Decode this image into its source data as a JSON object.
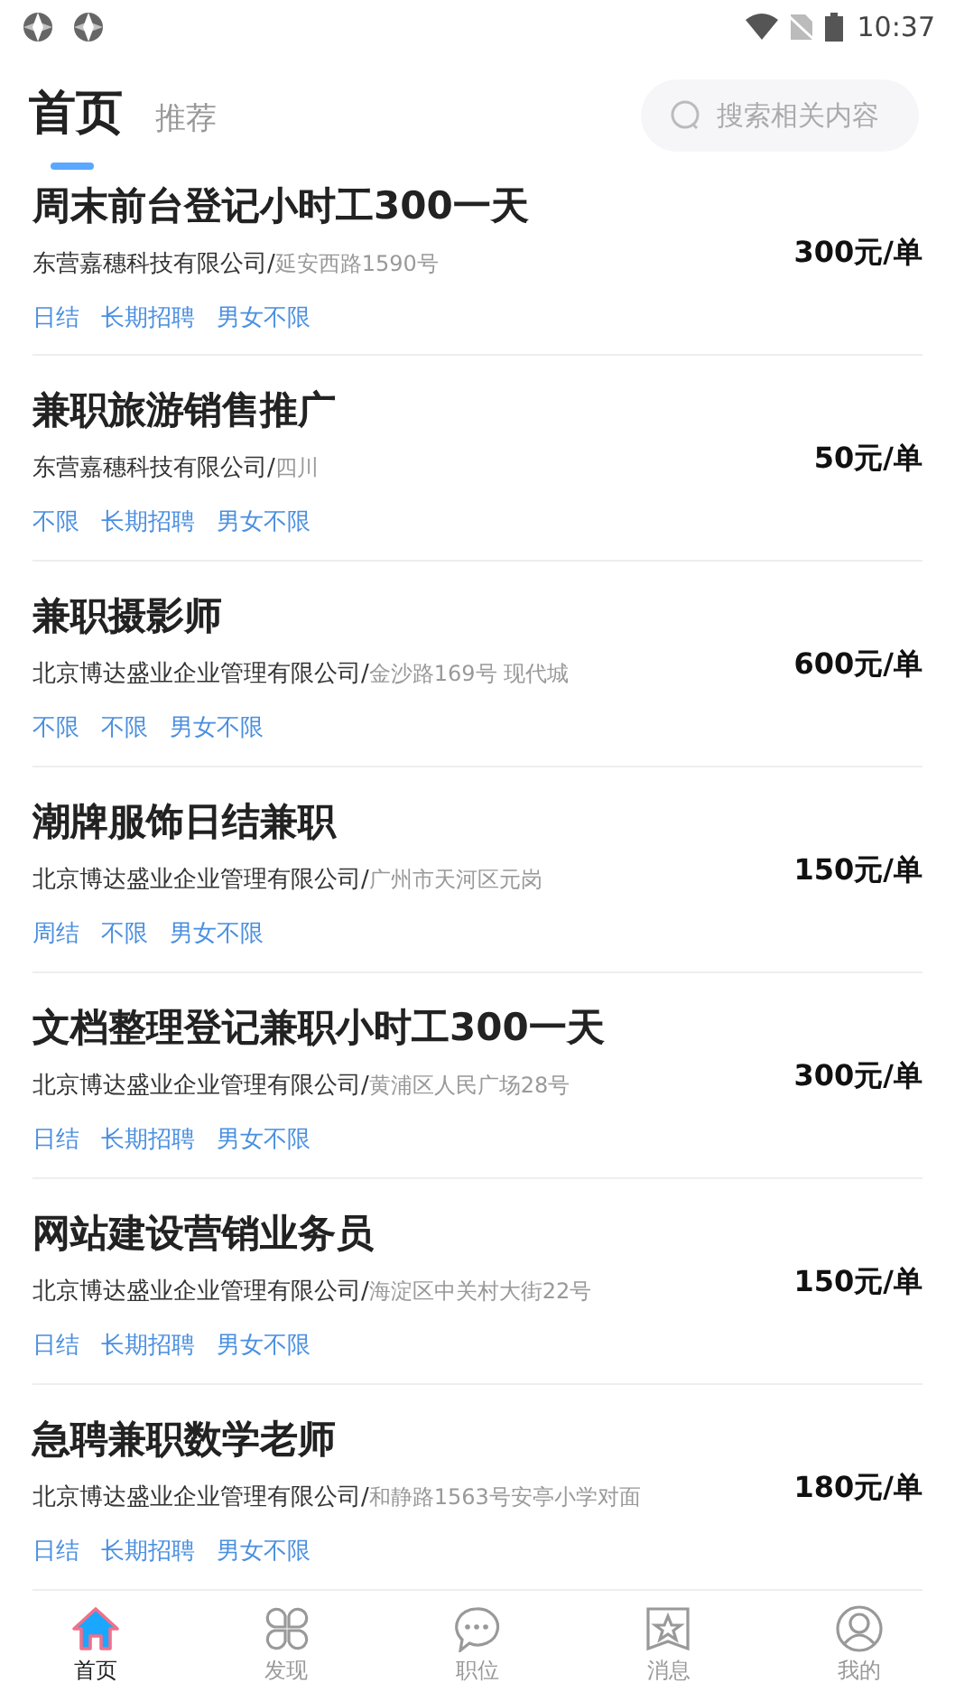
{
  "status_bar": {
    "time": "10:37"
  },
  "tabs": [
    {
      "label": "首页",
      "selected": true
    },
    {
      "label": "推荐",
      "selected": false
    }
  ],
  "search": {
    "placeholder": "搜索相关内容"
  },
  "jobs": [
    {
      "title": "周末前台登记小时工300一天",
      "company": "东营嘉穗科技有限公司/",
      "location": "延安西路1590号",
      "price": "300元/单",
      "tags": [
        "日结",
        "长期招聘",
        "男女不限"
      ]
    },
    {
      "title": "兼职旅游销售推广",
      "company": "东营嘉穗科技有限公司/",
      "location": "四川",
      "price": "50元/单",
      "tags": [
        "不限",
        "长期招聘",
        "男女不限"
      ]
    },
    {
      "title": "兼职摄影师",
      "company": "北京博达盛业企业管理有限公司/",
      "location": "金沙路169号 现代城",
      "price": "600元/单",
      "tags": [
        "不限",
        "不限",
        "男女不限"
      ]
    },
    {
      "title": "潮牌服饰日结兼职",
      "company": "北京博达盛业企业管理有限公司/",
      "location": "广州市天河区元岗",
      "price": "150元/单",
      "tags": [
        "周结",
        "不限",
        "男女不限"
      ]
    },
    {
      "title": "文档整理登记兼职小时工300一天",
      "company": "北京博达盛业企业管理有限公司/",
      "location": "黄浦区人民广场28号",
      "price": "300元/单",
      "tags": [
        "日结",
        "长期招聘",
        "男女不限"
      ]
    },
    {
      "title": "网站建设营销业务员",
      "company": "北京博达盛业企业管理有限公司/",
      "location": "海淀区中关村大街22号",
      "price": "150元/单",
      "tags": [
        "日结",
        "长期招聘",
        "男女不限"
      ]
    },
    {
      "title": "急聘兼职数学老师",
      "company": "北京博达盛业企业管理有限公司/",
      "location": "和静路1563号安亭小学对面",
      "price": "180元/单",
      "tags": [
        "日结",
        "长期招聘",
        "男女不限"
      ]
    }
  ],
  "bottom_nav": [
    {
      "label": "首页",
      "kind": "home",
      "selected": true
    },
    {
      "label": "发现",
      "kind": "discover",
      "selected": false
    },
    {
      "label": "职位",
      "kind": "chat",
      "selected": false
    },
    {
      "label": "消息",
      "kind": "star",
      "selected": false
    },
    {
      "label": "我的",
      "kind": "user",
      "selected": false
    }
  ]
}
